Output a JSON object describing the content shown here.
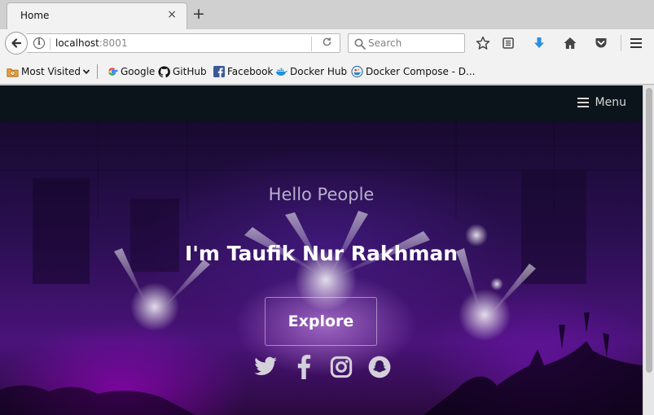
{
  "browser": {
    "tab": {
      "title": "Home",
      "close_icon": "×"
    },
    "new_tab_icon": "+",
    "url": {
      "host": "localhost",
      "port": ":8001"
    },
    "search": {
      "placeholder": "Search"
    },
    "toolbar_icons": [
      "back-arrow-icon",
      "info-icon",
      "reload-icon",
      "star-icon",
      "reading-list-icon",
      "download-icon",
      "home-icon",
      "pocket-icon",
      "hamburger-menu-icon"
    ],
    "accent_color": "#2a90e0"
  },
  "bookmarks": [
    {
      "label": "Most Visited",
      "icon": "most-visited-icon"
    },
    {
      "label": "Google",
      "icon": "google-icon"
    },
    {
      "label": "GitHub",
      "icon": "github-icon"
    },
    {
      "label": "Facebook",
      "icon": "facebook-icon"
    },
    {
      "label": "Docker Hub",
      "icon": "docker-icon"
    },
    {
      "label": "Docker Compose - D...",
      "icon": "docker-compose-icon"
    }
  ],
  "site": {
    "menu_label": "Menu",
    "greeting": "Hello People",
    "name": "I'm Taufik Nur Rakhman",
    "button_label": "Explore",
    "social_icons": [
      "twitter-icon",
      "facebook-icon",
      "instagram-icon",
      "snapchat-icon"
    ]
  }
}
